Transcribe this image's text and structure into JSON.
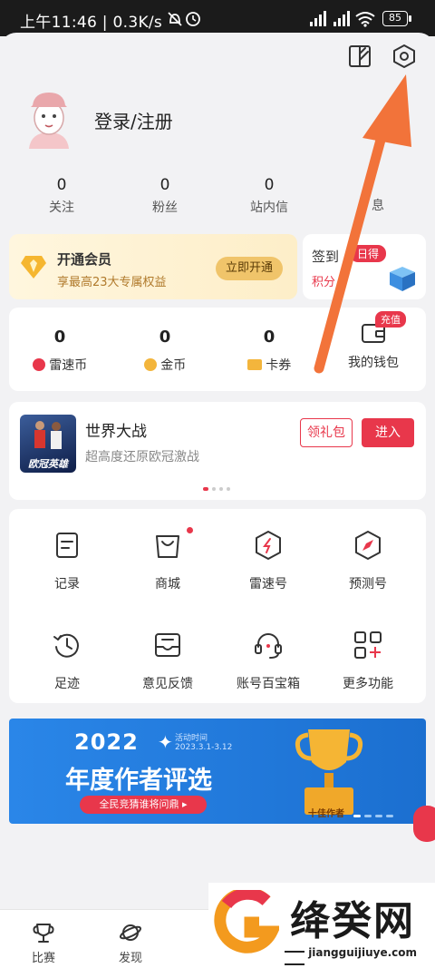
{
  "status_bar": {
    "time_speed": "上午11:46 | 0.3K/s",
    "battery": "85"
  },
  "user": {
    "login_label": "登录/注册"
  },
  "stats": [
    {
      "value": "0",
      "label": "关注"
    },
    {
      "value": "0",
      "label": "粉丝"
    },
    {
      "value": "0",
      "label": "站内信"
    },
    {
      "value": "",
      "label": "息"
    }
  ],
  "vip": {
    "title": "开通会员",
    "subtitle": "享最高23大专属权益",
    "button": "立即开通"
  },
  "checkin": {
    "title": "签到",
    "badge": "日得",
    "subtitle": "积分"
  },
  "wallet": {
    "items": [
      {
        "value": "0",
        "label": "雷速币"
      },
      {
        "value": "0",
        "label": "金币"
      },
      {
        "value": "0",
        "label": "卡券"
      }
    ],
    "my_wallet": "我的钱包",
    "recharge_badge": "充值"
  },
  "game": {
    "title": "世界大战",
    "subtitle": "超高度还原欧冠激战",
    "thumb_text": "欧冠英雄",
    "gift_button": "领礼包",
    "enter_button": "进入"
  },
  "features": [
    {
      "label": "记录",
      "icon": "record-icon"
    },
    {
      "label": "商城",
      "icon": "shop-bag-icon"
    },
    {
      "label": "雷速号",
      "icon": "lightning-hexagon-icon"
    },
    {
      "label": "预测号",
      "icon": "compass-hexagon-icon"
    },
    {
      "label": "足迹",
      "icon": "history-clock-icon"
    },
    {
      "label": "意见反馈",
      "icon": "feedback-tray-icon"
    },
    {
      "label": "账号百宝箱",
      "icon": "headset-icon"
    },
    {
      "label": "更多功能",
      "icon": "grid-plus-icon"
    }
  ],
  "banner": {
    "year": "2022",
    "period_label": "活动时间",
    "period_dates": "2023.3.1-3.12",
    "title": "年度作者评选",
    "subtitle": "全民竞猜谁将问鼎 ▸",
    "trophy_label": "十佳作者"
  },
  "bottom_nav": [
    {
      "label": "比赛",
      "icon": "trophy-icon"
    },
    {
      "label": "发现",
      "icon": "planet-icon"
    }
  ],
  "watermark": {
    "title": "绛癸网",
    "url": "jiangguijiuye.com"
  },
  "colors": {
    "accent": "#e8374b",
    "arrow": "#f2733a",
    "gold": "#f3b53c",
    "banner_blue": "#1f79d9"
  }
}
